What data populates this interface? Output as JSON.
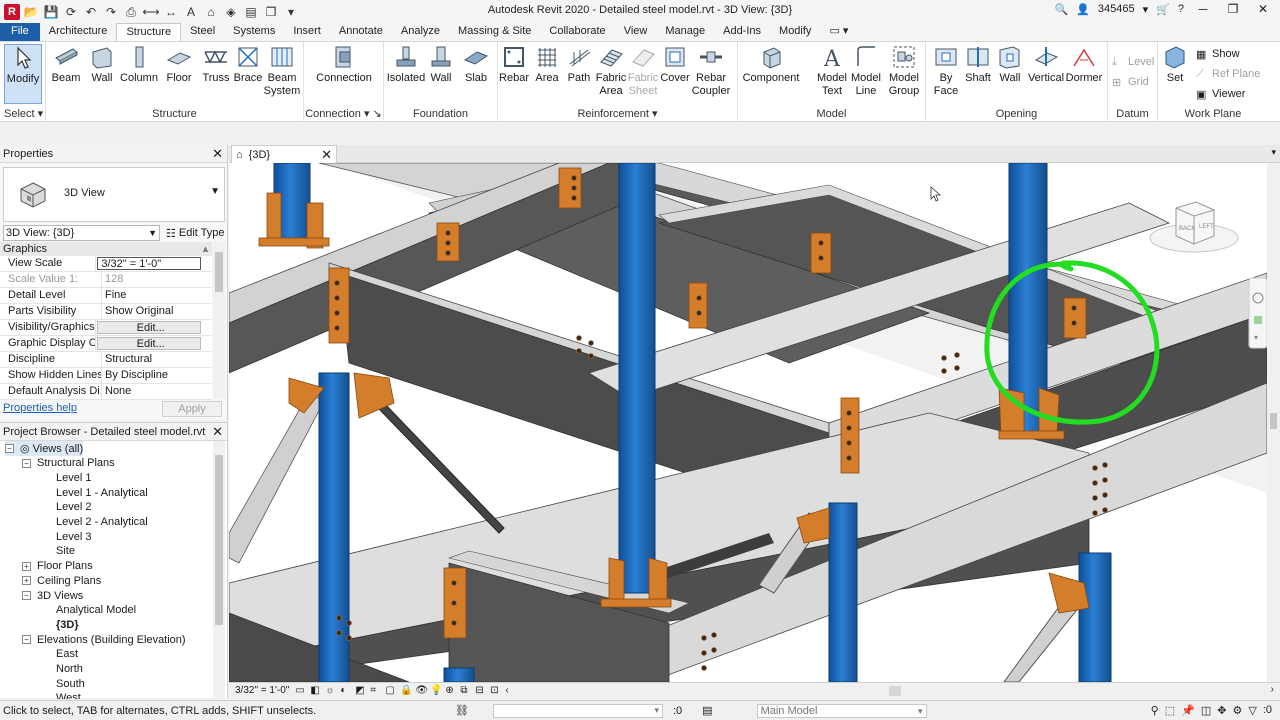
{
  "app": {
    "title": "Autodesk Revit 2020 - Detailed steel model.rvt - 3D View: {3D}",
    "user": "345465",
    "logo_letter": "R"
  },
  "ribbon_tabs": [
    "File",
    "Architecture",
    "Structure",
    "Steel",
    "Systems",
    "Insert",
    "Annotate",
    "Analyze",
    "Massing & Site",
    "Collaborate",
    "View",
    "Manage",
    "Add-Ins",
    "Modify"
  ],
  "active_tab": "Structure",
  "ribbon": {
    "select": {
      "modify": "Modify",
      "label": "Select"
    },
    "structure": {
      "label": "Structure",
      "buttons": [
        "Beam",
        "Wall",
        "Column",
        "Floor",
        "Truss",
        "Brace",
        "Beam System"
      ]
    },
    "connection": {
      "label": "Connection",
      "buttons": [
        "Connection"
      ]
    },
    "foundation": {
      "label": "Foundation",
      "buttons": [
        "Isolated",
        "Wall",
        "Slab"
      ]
    },
    "reinforcement": {
      "label": "Reinforcement",
      "buttons": [
        "Rebar",
        "Area",
        "Path",
        "Fabric Area",
        "Fabric Sheet",
        "Cover",
        "Rebar Coupler"
      ]
    },
    "model": {
      "label": "Model",
      "buttons": [
        "Component",
        "Model Text",
        "Model Line",
        "Model Group"
      ]
    },
    "opening": {
      "label": "Opening",
      "buttons": [
        "By Face",
        "Shaft",
        "Wall",
        "Vertical",
        "Dormer"
      ]
    },
    "datum": {
      "label": "Datum",
      "buttons": [
        "Level",
        "Grid"
      ]
    },
    "workplane": {
      "label": "Work Plane",
      "set": "Set",
      "show": "Show",
      "ref_plane": "Ref Plane",
      "viewer": "Viewer"
    }
  },
  "properties": {
    "title": "Properties",
    "type_name": "3D View",
    "instance": "3D View: {3D}",
    "edit_type": "Edit Type",
    "group": "Graphics",
    "rows": [
      {
        "name": "View Scale",
        "value": "3/32\" = 1'-0\""
      },
      {
        "name": "Scale Value    1:",
        "value": "128"
      },
      {
        "name": "Detail Level",
        "value": "Fine"
      },
      {
        "name": "Parts Visibility",
        "value": "Show Original"
      },
      {
        "name": "Visibility/Graphics ...",
        "value": "Edit..."
      },
      {
        "name": "Graphic Display Op...",
        "value": "Edit..."
      },
      {
        "name": "Discipline",
        "value": "Structural"
      },
      {
        "name": "Show Hidden Lines",
        "value": "By Discipline"
      },
      {
        "name": "Default Analysis Di...",
        "value": "None"
      }
    ],
    "help": "Properties help",
    "apply": "Apply"
  },
  "browser": {
    "title": "Project Browser - Detailed steel model.rvt",
    "tree": [
      {
        "label": "Views (all)",
        "level": 0,
        "exp": "-"
      },
      {
        "label": "Structural Plans",
        "level": 1,
        "exp": "-"
      },
      {
        "label": "Level 1",
        "level": 2
      },
      {
        "label": "Level 1 - Analytical",
        "level": 2
      },
      {
        "label": "Level 2",
        "level": 2
      },
      {
        "label": "Level 2 - Analytical",
        "level": 2
      },
      {
        "label": "Level 3",
        "level": 2
      },
      {
        "label": "Site",
        "level": 2
      },
      {
        "label": "Floor Plans",
        "level": 1,
        "exp": "+"
      },
      {
        "label": "Ceiling Plans",
        "level": 1,
        "exp": "+"
      },
      {
        "label": "3D Views",
        "level": 1,
        "exp": "-"
      },
      {
        "label": "Analytical Model",
        "level": 2
      },
      {
        "label": "{3D}",
        "level": 2,
        "bold": true
      },
      {
        "label": "Elevations (Building Elevation)",
        "level": 1,
        "exp": "-"
      },
      {
        "label": "East",
        "level": 2
      },
      {
        "label": "North",
        "level": 2
      },
      {
        "label": "South",
        "level": 2
      },
      {
        "label": "West",
        "level": 2
      }
    ]
  },
  "view": {
    "tab_label": "{3D}",
    "scale": "3/32\" = 1'-0\"",
    "viewcube_back": "BACK",
    "viewcube_left": "LEFT"
  },
  "status": {
    "text": "Click to select, TAB for alternates, CTRL adds, SHIFT unselects.",
    "zero": ":0",
    "model": "Main Model",
    "filter_count": ":0"
  },
  "colors": {
    "file_tab": "#1d5ea8",
    "column_blue": "#1f6fc4",
    "connection_orange": "#d47d2a",
    "highlight_green": "#22dd22",
    "beam_dark": "#4f4f4f",
    "beam_light": "#c9c9c9"
  }
}
